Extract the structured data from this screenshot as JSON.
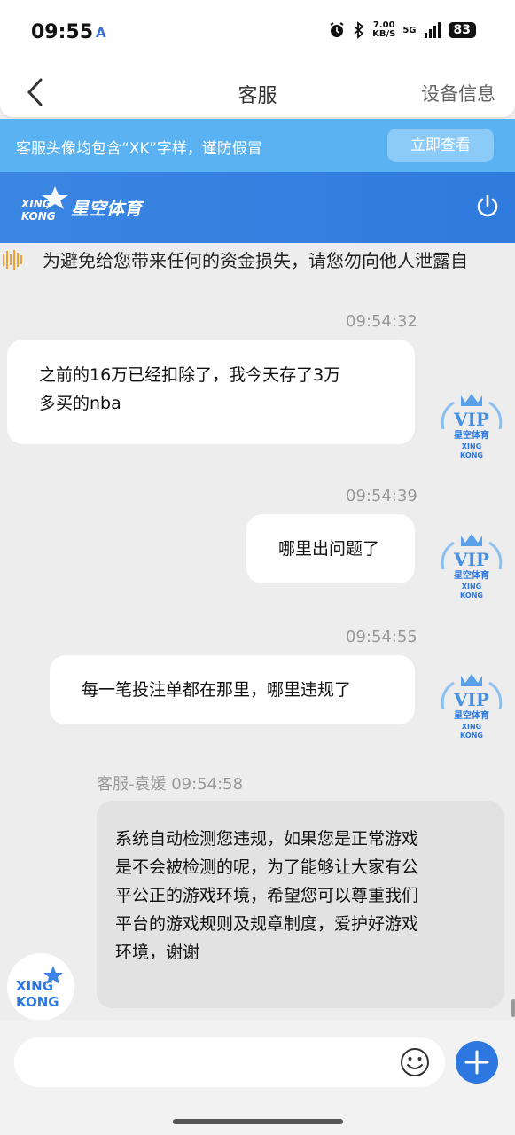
{
  "status_bar": {
    "time": "09:55",
    "a_indicator": "A",
    "alarm_icon": "alarm-icon",
    "bluetooth_icon": "bluetooth-icon",
    "speed_value": "7.00",
    "speed_unit": "KB/S",
    "network": "5G",
    "signal_icon": "signal-icon",
    "battery": "83"
  },
  "nav": {
    "title": "客服",
    "device_info": "设备信息",
    "back_icon": "chevron-left-icon"
  },
  "banner": {
    "text": "客服头像均包含“XK”字样，谨防假冒",
    "button": "立即查看"
  },
  "brand": {
    "logo_word1": "XING",
    "logo_word2": "KONG",
    "logo_cn": "星空体育",
    "power_icon": "power-icon"
  },
  "notice": {
    "text": "为避免给您带来任何的资金损失，请您勿向他人泄露自",
    "icon": "sound-wave-icon"
  },
  "messages": [
    {
      "sender": "user",
      "time": "09:54:32",
      "text_lines": [
        "之前的16万已经扣除了，我今天存了3万",
        "多买的nba"
      ]
    },
    {
      "sender": "user",
      "time": "09:54:39",
      "text_lines": [
        "哪里出问题了"
      ]
    },
    {
      "sender": "user",
      "time": "09:54:55",
      "text_lines": [
        "每一笔投注单都在那里，哪里违规了"
      ]
    },
    {
      "sender": "agent",
      "name": "客服-袁媛",
      "time": "09:54:58",
      "text_lines": [
        "系统自动检测您违规，如果您是正常游戏",
        "是不会被检测的呢，为了能够让大家有公",
        "平公正的游戏环境，希望您可以尊重我们",
        "平台的游戏规则及规章制度，爱护好游戏",
        "环境，谢谢"
      ]
    }
  ],
  "avatar": {
    "vip_text": "VIP",
    "vip_cn": "星空体育",
    "vip_word1": "XING",
    "vip_word2": "KONG",
    "agent_word1": "XING",
    "agent_word2": "KONG"
  },
  "input": {
    "placeholder": "",
    "emoji_icon": "emoji-icon",
    "plus_icon": "plus-icon"
  },
  "colors": {
    "accent": "#2d78e0",
    "banner": "#5ab2f2",
    "brand_header": "#3b86e3"
  }
}
